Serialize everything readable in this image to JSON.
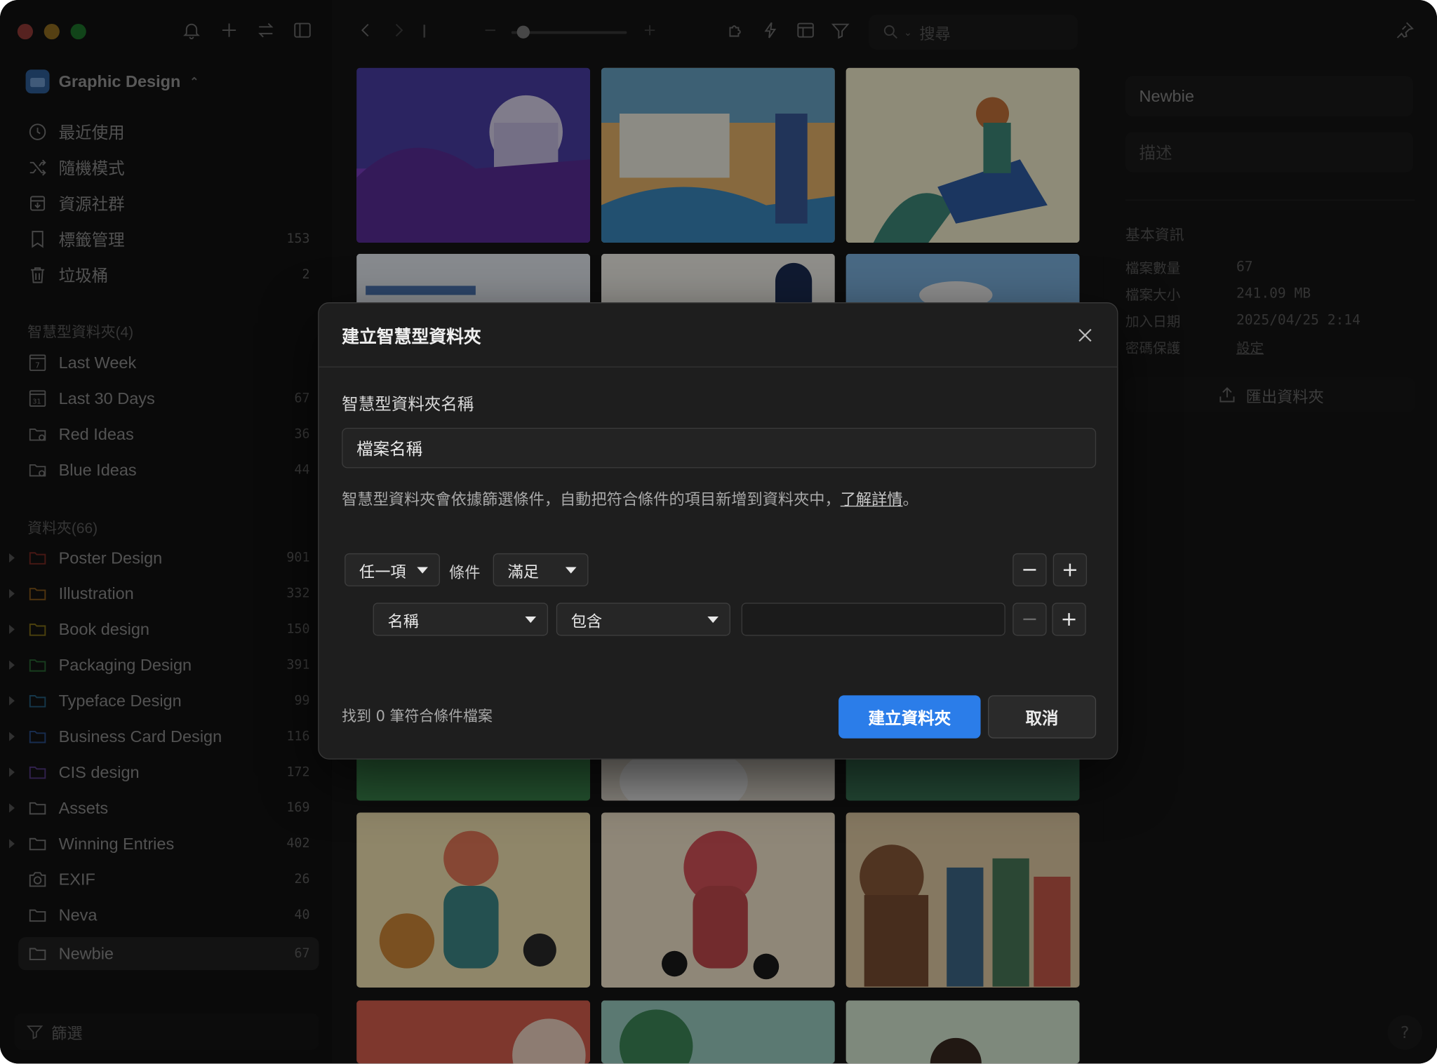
{
  "library": {
    "name": "Graphic Design"
  },
  "nav": {
    "items": [
      {
        "label": "最近使用",
        "icon": "clock-icon",
        "count": ""
      },
      {
        "label": "隨機模式",
        "icon": "shuffle-icon",
        "count": ""
      },
      {
        "label": "資源社群",
        "icon": "download-box-icon",
        "count": ""
      },
      {
        "label": "標籤管理",
        "icon": "bookmark-icon",
        "count": "153"
      },
      {
        "label": "垃圾桶",
        "icon": "trash-icon",
        "count": "2"
      }
    ]
  },
  "smart_folders": {
    "header": "智慧型資料夾(4)",
    "items": [
      {
        "label": "Last Week",
        "icon": "calendar-7-icon",
        "count": ""
      },
      {
        "label": "Last 30 Days",
        "icon": "calendar-31-icon",
        "count": "67"
      },
      {
        "label": "Red Ideas",
        "icon": "smart-folder-icon",
        "count": "36"
      },
      {
        "label": "Blue Ideas",
        "icon": "smart-folder-icon",
        "count": "44"
      }
    ]
  },
  "folders": {
    "header": "資料夾(66)",
    "items": [
      {
        "label": "Poster Design",
        "color": "#c0392b",
        "count": "901"
      },
      {
        "label": "Illustration",
        "color": "#d98a1c",
        "count": "332"
      },
      {
        "label": "Book design",
        "color": "#caa21a",
        "count": "150"
      },
      {
        "label": "Packaging Design",
        "color": "#2f9e44",
        "count": "391"
      },
      {
        "label": "Typeface Design",
        "color": "#2a8fc4",
        "count": "99"
      },
      {
        "label": "Business Card Design",
        "color": "#2f6fd1",
        "count": "116"
      },
      {
        "label": "CIS design",
        "color": "#7b4fc7",
        "count": "172"
      },
      {
        "label": "Assets",
        "color": "#8a8a8a",
        "count": "169"
      },
      {
        "label": "Winning Entries",
        "color": "#8a8a8a",
        "count": "402"
      },
      {
        "label": "EXIF",
        "color": "#8a8a8a",
        "count": "26"
      },
      {
        "label": "Neva",
        "color": "#8a8a8a",
        "count": "40"
      },
      {
        "label": "Newbie",
        "color": "#8a8a8a",
        "count": "67"
      }
    ]
  },
  "filter": {
    "label": "篩選"
  },
  "toolbar": {
    "search_placeholder": "搜尋"
  },
  "inspector": {
    "name": "Newbie",
    "description_placeholder": "描述",
    "section": "基本資訊",
    "rows": [
      {
        "label": "檔案數量",
        "value": "67"
      },
      {
        "label": "檔案大小",
        "value": "241.09 MB"
      },
      {
        "label": "加入日期",
        "value": "2025/04/25 2:14"
      },
      {
        "label": "密碼保護",
        "value": "設定"
      }
    ],
    "export_label": "匯出資料夾"
  },
  "dialog": {
    "title": "建立智慧型資料夾",
    "name_label": "智慧型資料夾名稱",
    "name_value": "檔案名稱",
    "description": "智慧型資料夾會依據篩選條件，自動把符合條件的項目新增到資料夾中，",
    "learn_more": "了解詳情",
    "period": "。",
    "match_mode": "任一項",
    "conditions_word": "條件",
    "satisfy": "滿足",
    "field": "名稱",
    "operator": "包含",
    "value": "",
    "found_text": "找到 0 筆符合條件檔案",
    "create_button": "建立資料夾",
    "cancel_button": "取消"
  },
  "colors": {
    "accent": "#2b7de9",
    "traffic_red": "#ff5f57",
    "traffic_yellow": "#febc2e",
    "traffic_green": "#28c840"
  }
}
